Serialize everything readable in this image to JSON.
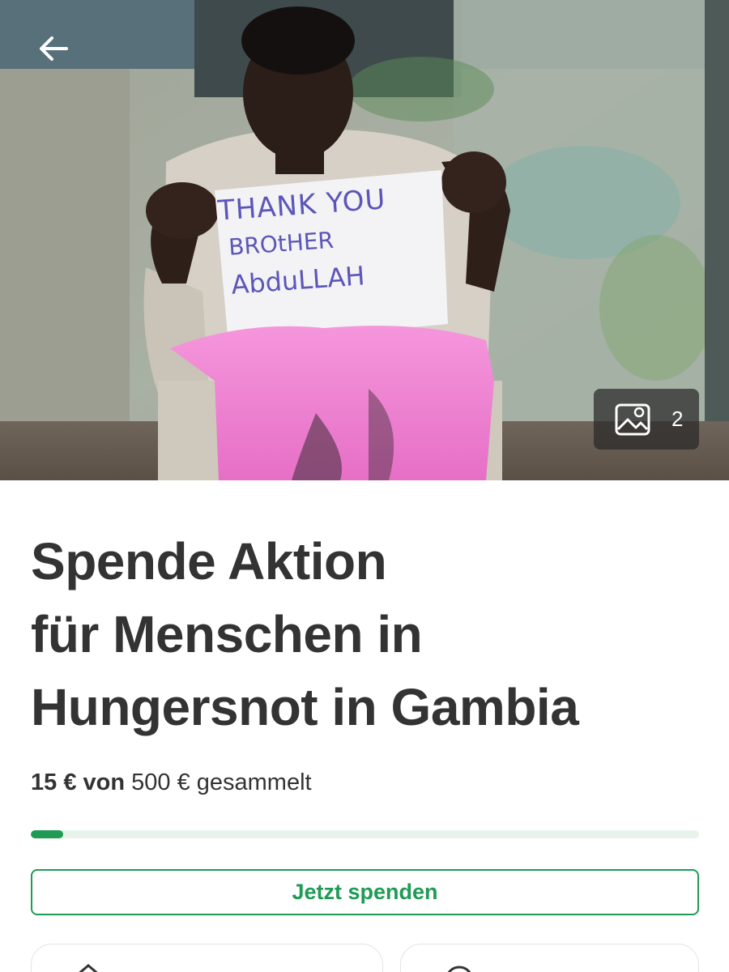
{
  "hero": {
    "sign_text": [
      "THANK YOU",
      "BROtHER",
      "AbduLLAH"
    ],
    "back_icon": "arrow-left-icon",
    "gallery": {
      "icon": "image-icon",
      "count": "2"
    }
  },
  "campaign": {
    "title_lines": [
      "Spende Aktion",
      "für Menschen in",
      "Hungersnot in Gambia"
    ],
    "raised_amount": "15 € von",
    "goal_text": "500 € gesammelt",
    "progress_fraction": 0.03,
    "donate_label": "Jetzt spenden"
  },
  "cards": {
    "left_icon": "share-icon",
    "right_icon": "chat-icon"
  },
  "colors": {
    "accent": "#1f9b55",
    "progress_track": "#e6f4ec",
    "text": "#333333",
    "sack_pink": "#f07ad0"
  }
}
